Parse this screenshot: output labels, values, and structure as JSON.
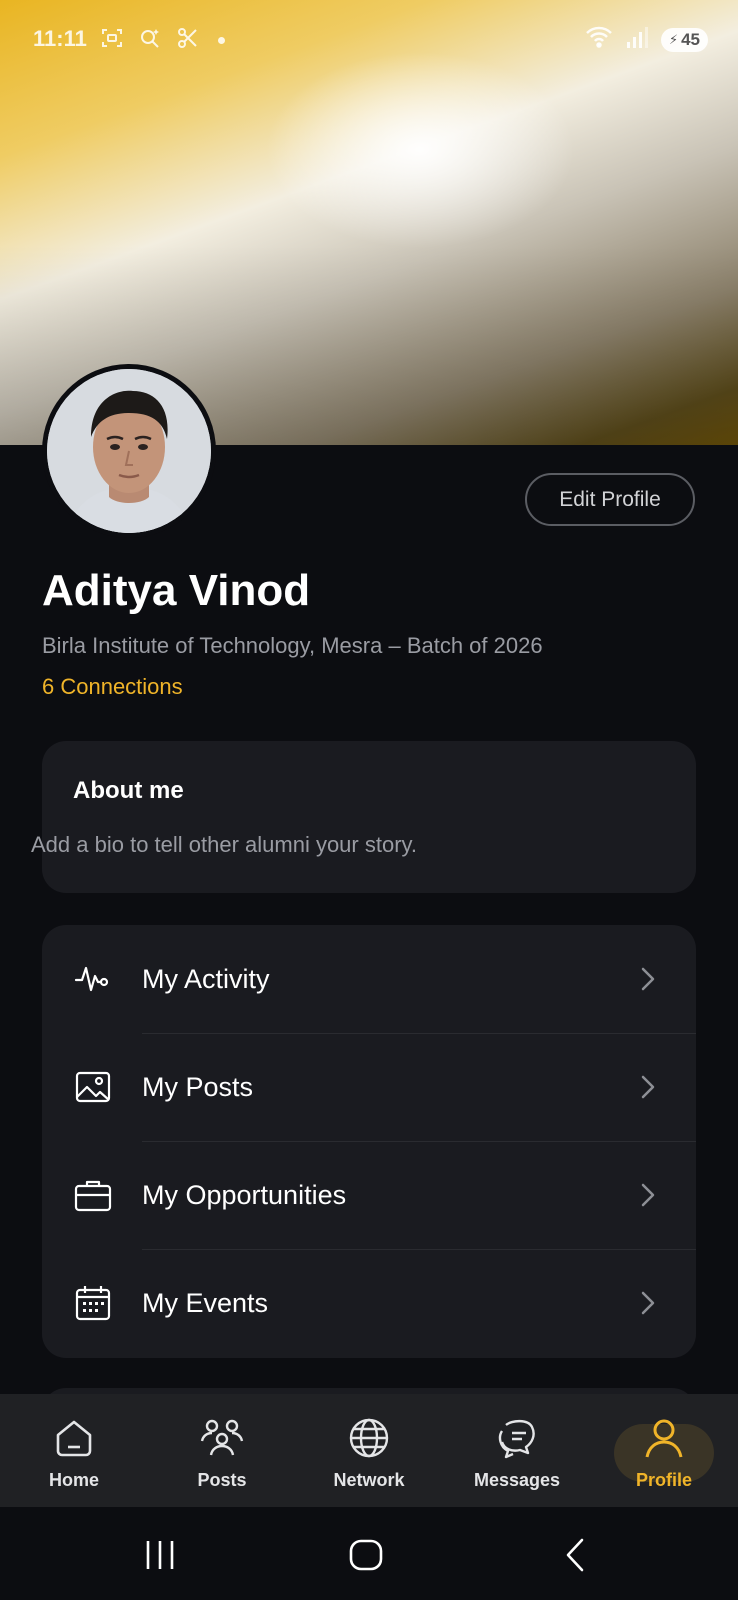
{
  "status_bar": {
    "time": "11:11",
    "battery": "45",
    "icons": [
      "screenshot-icon",
      "search-sparkle-icon",
      "scissors-icon",
      "wifi-icon",
      "signal-icon",
      "battery-icon"
    ]
  },
  "profile": {
    "name": "Aditya Vinod",
    "subtitle": "Birla Institute of Technology, Mesra – Batch of 2026",
    "connections": "6 Connections",
    "edit_label": "Edit Profile"
  },
  "about": {
    "title": "About me",
    "text": "Add a bio to tell other alumni your story."
  },
  "menu": {
    "items": [
      {
        "label": "My Activity",
        "icon": "activity-icon"
      },
      {
        "label": "My Posts",
        "icon": "image-icon"
      },
      {
        "label": "My Opportunities",
        "icon": "briefcase-icon"
      },
      {
        "label": "My Events",
        "icon": "calendar-icon"
      }
    ]
  },
  "bottom_nav": {
    "items": [
      {
        "label": "Home",
        "icon": "home-icon"
      },
      {
        "label": "Posts",
        "icon": "people-icon"
      },
      {
        "label": "Network",
        "icon": "globe-icon"
      },
      {
        "label": "Messages",
        "icon": "messages-icon"
      },
      {
        "label": "Profile",
        "icon": "profile-icon"
      }
    ],
    "active": "Profile"
  },
  "colors": {
    "accent": "#f0b429",
    "background": "#0c0d11",
    "card": "#1a1b20",
    "muted_text": "#9a9ca3"
  }
}
